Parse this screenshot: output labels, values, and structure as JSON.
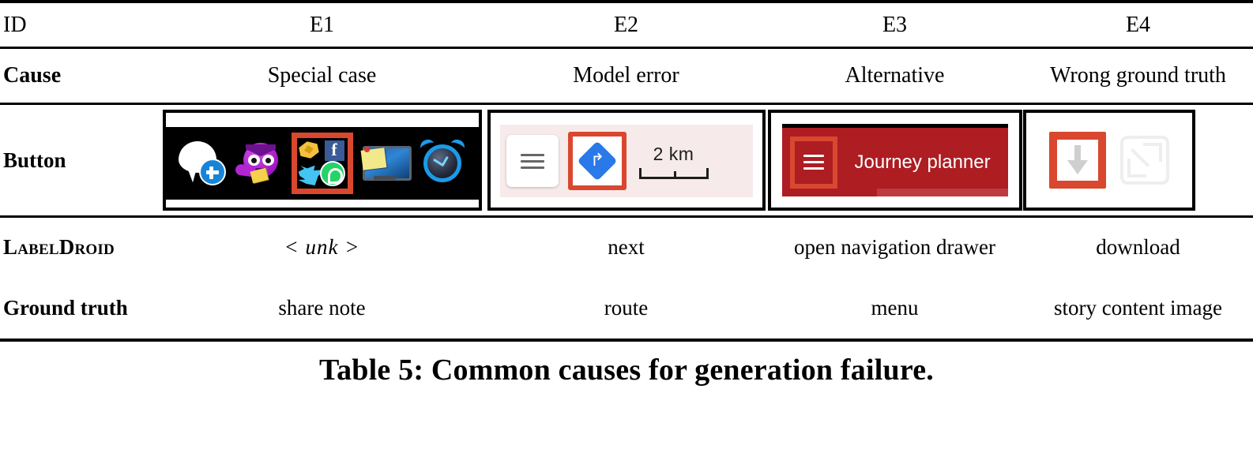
{
  "table": {
    "rows": [
      {
        "label": "ID",
        "label_style": "plain",
        "cells": [
          "E1",
          "E2",
          "E3",
          "E4"
        ]
      },
      {
        "label": "Cause",
        "label_style": "bold",
        "cells": [
          "Special case",
          "Model error",
          "Alternative",
          "Wrong ground truth"
        ]
      },
      {
        "label": "Button",
        "label_style": "bold",
        "cells": [
          "",
          "",
          "",
          ""
        ]
      },
      {
        "label": "LabelDroid",
        "label_style": "smallcaps",
        "cells": [
          "< unk >",
          "next",
          "open navigation drawer",
          "download"
        ]
      },
      {
        "label": "Ground truth",
        "label_style": "bold",
        "cells": [
          "share note",
          "route",
          "menu",
          "story content image"
        ]
      }
    ]
  },
  "screenshots": {
    "e1": {
      "background": "#000000",
      "icons": [
        {
          "name": "new-message-bubble-icon",
          "highlighted": false
        },
        {
          "name": "purple-monster-icon",
          "highlighted": false
        },
        {
          "name": "share-apps-icon",
          "highlighted": true
        },
        {
          "name": "sticky-note-monitor-icon",
          "highlighted": false
        },
        {
          "name": "alarm-clock-icon",
          "highlighted": false
        }
      ]
    },
    "e2": {
      "background": "#f6eaea",
      "menu_button": "hamburger-icon",
      "route_button": "route-diamond-icon",
      "route_arrow_glyph": "↱",
      "scale_label": "2 km",
      "highlighted": "route-diamond-icon"
    },
    "e3": {
      "bar_color": "#ad1d22",
      "title": "Journey planner",
      "menu_button": "hamburger-icon",
      "highlighted": "hamburger-icon"
    },
    "e4": {
      "download_button": "download-arrow-icon",
      "expand_button": "fullscreen-expand-icon",
      "highlighted": "download-arrow-icon"
    },
    "highlight_color": "#d9472f"
  },
  "caption": "Table 5: Common causes for generation failure."
}
